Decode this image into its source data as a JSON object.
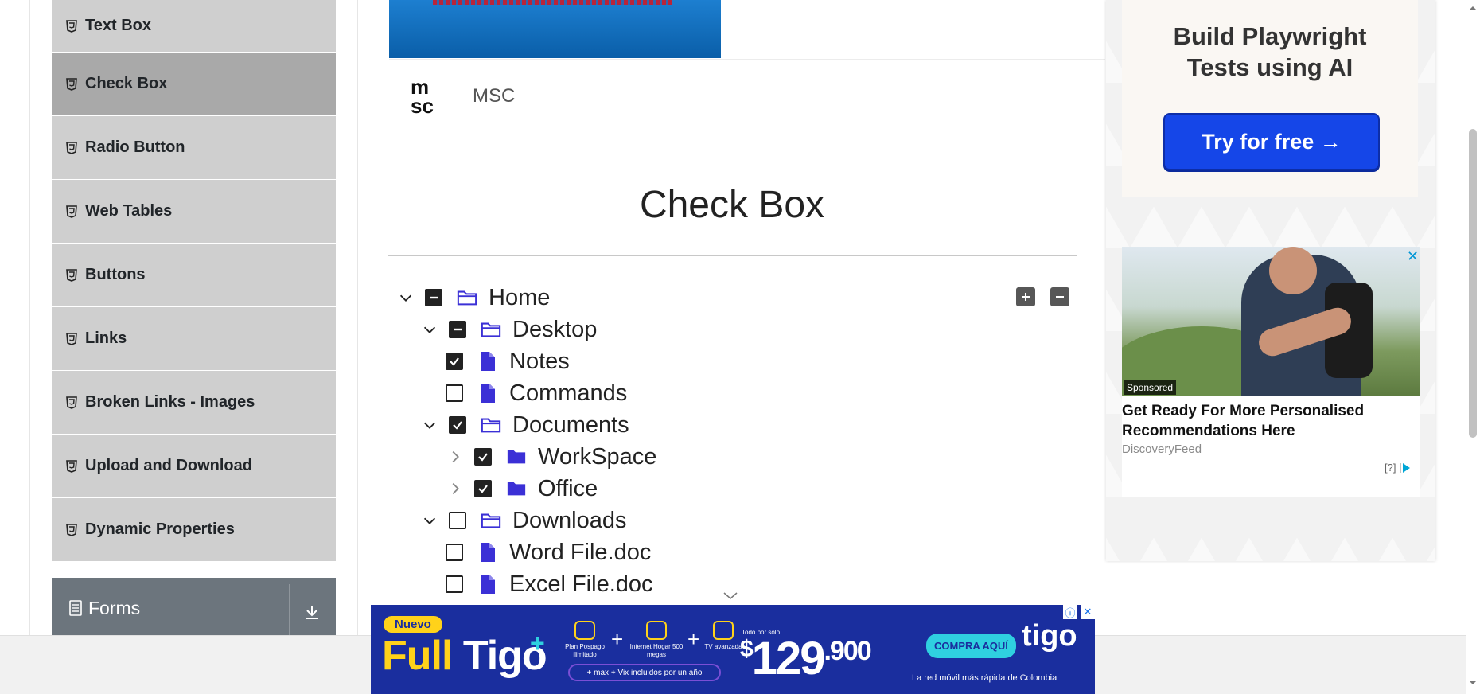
{
  "sidebar": {
    "items": [
      {
        "label": "Text Box",
        "active": false
      },
      {
        "label": "Check Box",
        "active": true
      },
      {
        "label": "Radio Button",
        "active": false
      },
      {
        "label": "Web Tables",
        "active": false
      },
      {
        "label": "Buttons",
        "active": false
      },
      {
        "label": "Links",
        "active": false
      },
      {
        "label": "Broken Links - Images",
        "active": false
      },
      {
        "label": "Upload and Download",
        "active": false
      },
      {
        "label": "Dynamic Properties",
        "active": false
      }
    ],
    "forms_label": "Forms"
  },
  "banner": {
    "brand": "MSC"
  },
  "main": {
    "title": "Check Box"
  },
  "tree": {
    "nodes": [
      {
        "label": "Home",
        "state": "half",
        "type": "folder",
        "expanded": true,
        "level": 0
      },
      {
        "label": "Desktop",
        "state": "half",
        "type": "folder",
        "expanded": true,
        "level": 1
      },
      {
        "label": "Notes",
        "state": "checked",
        "type": "file",
        "level": 2
      },
      {
        "label": "Commands",
        "state": "unchecked",
        "type": "file",
        "level": 2
      },
      {
        "label": "Documents",
        "state": "checked",
        "type": "folder",
        "expanded": true,
        "level": 1
      },
      {
        "label": "WorkSpace",
        "state": "checked",
        "type": "folder",
        "expanded": false,
        "level": 2
      },
      {
        "label": "Office",
        "state": "checked",
        "type": "folder",
        "expanded": false,
        "level": 2
      },
      {
        "label": "Downloads",
        "state": "unchecked",
        "type": "folder",
        "expanded": true,
        "level": 1
      },
      {
        "label": "Word File.doc",
        "state": "unchecked",
        "type": "file",
        "level": 2
      },
      {
        "label": "Excel File.doc",
        "state": "unchecked",
        "type": "file",
        "level": 2
      }
    ]
  },
  "ads": {
    "playwright": {
      "title_line1": "Build Playwright",
      "title_line2": "Tests using AI",
      "button": "Try for free →"
    },
    "news": {
      "sponsored": "Sponsored",
      "headline": "Get Ready For More Personalised Recommendations Here",
      "source": "DiscoveryFeed",
      "adchoice": "[?]"
    },
    "tigo": {
      "nuevo": "Nuevo",
      "full": "Full",
      "tigo_word": "Tigo",
      "feature1": "Plan Pospago ilimitado",
      "feature2": "Internet Hogar 500 megas",
      "feature3": "TV avanzada",
      "included": "+ max + Vix incluidos por un año",
      "solo": "Todo por solo",
      "currency": "$",
      "price": "129",
      "cents": ".900",
      "cta": "COMPRA AQUÍ",
      "logo": "tigo",
      "tagline": "La red móvil más rápida de Colombia"
    }
  },
  "colors": {
    "sidebar_item": "#cfcfcf",
    "sidebar_active": "#a9a9a9",
    "forms_header": "#6c757d",
    "tree_icon": "#3b30d6",
    "pw_button": "#1546e8"
  }
}
